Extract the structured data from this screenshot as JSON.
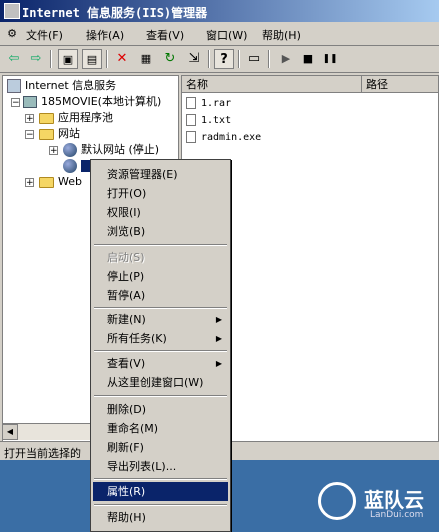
{
  "window": {
    "title": "Internet 信息服务(IIS)管理器"
  },
  "menubar": {
    "items": [
      "文件(F)",
      "操作(A)",
      "查看(V)",
      "窗口(W)",
      "帮助(H)"
    ]
  },
  "toolbar": {
    "buttons": [
      {
        "name": "back-icon",
        "glyph": "⇦"
      },
      {
        "name": "forward-icon",
        "glyph": "⇨"
      },
      {
        "name": "up-folder-icon",
        "glyph": "▣"
      },
      {
        "name": "show-tree-icon",
        "glyph": "▤"
      },
      {
        "name": "delete-icon",
        "glyph": "✕"
      },
      {
        "name": "properties-icon",
        "glyph": "▦"
      },
      {
        "name": "refresh-icon",
        "glyph": "↻"
      },
      {
        "name": "export-icon",
        "glyph": "⇲"
      },
      {
        "name": "help-icon",
        "glyph": "?"
      },
      {
        "name": "computer-icon",
        "glyph": "▭"
      },
      {
        "name": "play-icon",
        "glyph": "▶"
      },
      {
        "name": "stop-icon",
        "glyph": "■"
      },
      {
        "name": "pause-icon",
        "glyph": "❚❚"
      }
    ]
  },
  "tree": {
    "root": "Internet 信息服务",
    "computer": "185MOVIE(本地计算机)",
    "app_pools": "应用程序池",
    "websites": "网站",
    "default_site": "默认网站 (停止)",
    "web_ext": "Web"
  },
  "list": {
    "columns": [
      "名称",
      "路径"
    ],
    "files": [
      "1.rar",
      "1.txt",
      "radmin.exe"
    ]
  },
  "status": {
    "text": "打开当前选择的"
  },
  "context_menu": {
    "items": [
      {
        "label": "资源管理器(E)",
        "disabled": false
      },
      {
        "label": "打开(O)",
        "disabled": false
      },
      {
        "label": "权限(I)",
        "disabled": false
      },
      {
        "label": "浏览(B)",
        "disabled": false
      },
      {
        "label": "启动(S)",
        "disabled": true
      },
      {
        "label": "停止(P)",
        "disabled": false
      },
      {
        "label": "暂停(A)",
        "disabled": false
      },
      {
        "label": "新建(N)",
        "disabled": false,
        "submenu": true
      },
      {
        "label": "所有任务(K)",
        "disabled": false,
        "submenu": true
      },
      {
        "label": "查看(V)",
        "disabled": false,
        "submenu": true
      },
      {
        "label": "从这里创建窗口(W)",
        "disabled": false
      },
      {
        "label": "删除(D)",
        "disabled": false
      },
      {
        "label": "重命名(M)",
        "disabled": false
      },
      {
        "label": "刷新(F)",
        "disabled": false
      },
      {
        "label": "导出列表(L)...",
        "disabled": false
      },
      {
        "label": "属性(R)",
        "disabled": false,
        "selected": true
      },
      {
        "label": "帮助(H)",
        "disabled": false
      }
    ]
  },
  "watermark": {
    "brand": "蓝队云",
    "site": "LanDui.com"
  }
}
